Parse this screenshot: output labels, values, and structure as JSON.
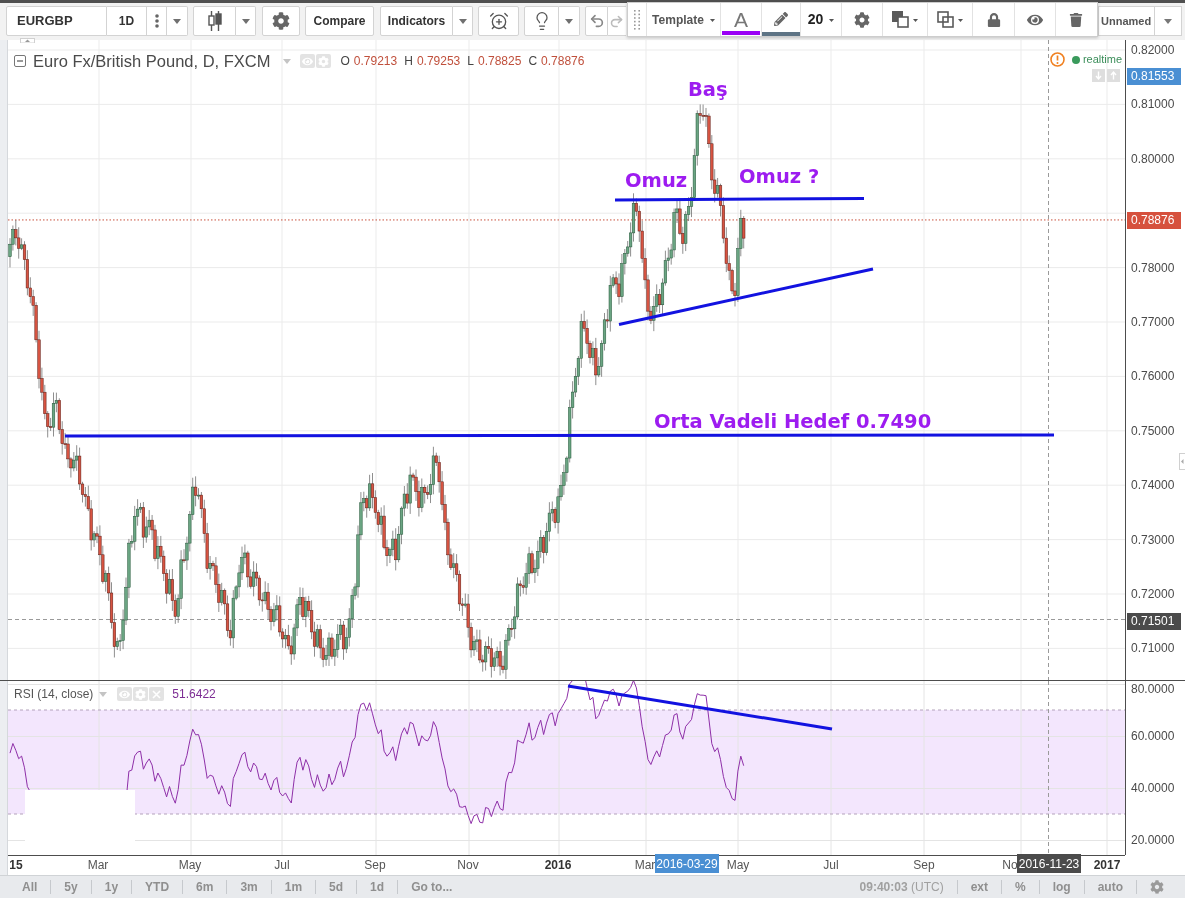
{
  "toolbar": {
    "symbol": "EURGBP",
    "interval": "1D",
    "compare": "Compare",
    "indicators": "Indicators"
  },
  "drawing_toolbar": {
    "template": "Template",
    "color_tools": [
      {
        "kind": "text",
        "label": "A",
        "color": "#9a00f5"
      },
      {
        "kind": "line",
        "color": "#5e7485"
      }
    ],
    "font_size": "20"
  },
  "layout_menu": {
    "name": "Unnamed"
  },
  "legend": {
    "title": "Euro Fx/British Pound, D, FXCM",
    "values": [
      {
        "label": "O",
        "value": "0.79213"
      },
      {
        "label": "H",
        "value": "0.79253"
      },
      {
        "label": "L",
        "value": "0.78825"
      },
      {
        "label": "C",
        "value": "0.78876"
      }
    ]
  },
  "status": {
    "label": "realtime"
  },
  "annotations": [
    "Baş",
    "Omuz",
    "Omuz ?",
    "Orta Vadeli Hedef 0.7490"
  ],
  "price_axis": {
    "ticks": [
      "0.82000",
      "0.81000",
      "0.80000",
      "0.78000",
      "0.77000",
      "0.76000",
      "0.75000",
      "0.74000",
      "0.73000",
      "0.72000",
      "0.71000"
    ],
    "badges": [
      {
        "kind": "high",
        "value": "0.81553"
      },
      {
        "kind": "last",
        "value": "0.78876"
      },
      {
        "kind": "crosshair",
        "value": "0.71501"
      }
    ]
  },
  "rsi": {
    "title": "RSI (14, close)",
    "value": "51.6422",
    "ticks": [
      "80.0000",
      "60.0000",
      "40.0000",
      "20.0000"
    ]
  },
  "time_axis": {
    "labels": [
      {
        "text": "15",
        "kind": "year"
      },
      {
        "text": "Mar",
        "kind": "month"
      },
      {
        "text": "May",
        "kind": "month"
      },
      {
        "text": "Jul",
        "kind": "month"
      },
      {
        "text": "Sep",
        "kind": "month"
      },
      {
        "text": "Nov",
        "kind": "month"
      },
      {
        "text": "2016",
        "kind": "year"
      },
      {
        "text": "Mar",
        "kind": "month"
      },
      {
        "text": "May",
        "kind": "month"
      },
      {
        "text": "Jul",
        "kind": "month"
      },
      {
        "text": "Sep",
        "kind": "month"
      },
      {
        "text": "No",
        "kind": "month"
      },
      {
        "text": "2017",
        "kind": "year"
      }
    ],
    "badges": [
      {
        "kind": "selection",
        "text": "2016-03-29"
      },
      {
        "kind": "crosshair",
        "text": "2016-11-23"
      }
    ]
  },
  "bottom_bar": {
    "ranges": [
      "All",
      "5y",
      "1y",
      "YTD",
      "6m",
      "3m",
      "1m",
      "5d",
      "1d"
    ],
    "goto": "Go to...",
    "clock": "**09:40:03** (UTC)",
    "options": [
      "ext",
      "%",
      "log",
      "auto"
    ]
  }
}
